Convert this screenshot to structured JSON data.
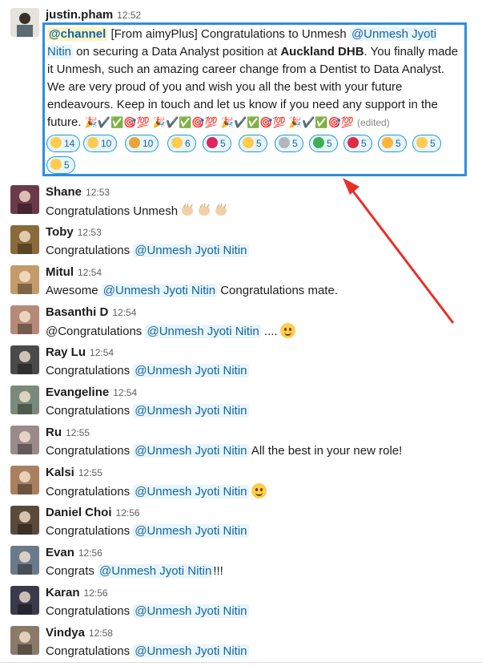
{
  "first_message": {
    "author": "justin.pham",
    "time": "12:52",
    "channel_tag": "@channel",
    "text_a": " [From aimyPlus] Congratulations to Unmesh ",
    "mention": "@Unmesh Jyoti Nitin",
    "text_b": " on securing a Data Analyst position at ",
    "bold": "Auckland DHB",
    "text_c": ". You finally made it Unmesh, such an amazing career change from a Dentist to Data Analyst. We are very proud of you and wish you all the best with your future endeavours. Keep in touch and let us know if you need any support in the future. ",
    "emoji_run": "🎉✔️✅🎯💯 🎉✔️✅🎯💯 🎉✔️✅🎯💯 🎉✔️✅🎯💯",
    "edited": "(edited)",
    "reactions": [
      {
        "icon": "thumbs-up-icon",
        "count": "14",
        "color": "#ffcc4d"
      },
      {
        "icon": "clap-icon",
        "count": "10",
        "color": "#ffcc4d"
      },
      {
        "icon": "party-popper-icon",
        "count": "10",
        "color": "#e8a33d"
      },
      {
        "icon": "grin-icon",
        "count": "6",
        "color": "#ffcc4d"
      },
      {
        "icon": "hundred-icon",
        "count": "5",
        "color": "#e0245e"
      },
      {
        "icon": "slight-smile-icon",
        "count": "5",
        "color": "#ffcc4d"
      },
      {
        "icon": "heavy-check-icon",
        "count": "5",
        "color": "#b0b8bf"
      },
      {
        "icon": "white-check-icon",
        "count": "5",
        "color": "#3cb054"
      },
      {
        "icon": "target-icon",
        "count": "5",
        "color": "#dd2e44"
      },
      {
        "icon": "muscle-icon",
        "count": "5",
        "color": "#ffb536"
      },
      {
        "icon": "hugging-icon",
        "count": "5",
        "color": "#ffcc4d"
      },
      {
        "icon": "sun-icon",
        "count": "5",
        "color": "#ffcc4d"
      }
    ]
  },
  "messages": [
    {
      "author": "Shane",
      "time": "12:53",
      "pre": "Congratulations Unmesh",
      "mention": "",
      "post": "",
      "emoji": "clap3"
    },
    {
      "author": "Toby",
      "time": "12:53",
      "pre": "Congratulations ",
      "mention": "@Unmesh Jyoti Nitin",
      "post": "",
      "emoji": ""
    },
    {
      "author": "Mitul",
      "time": "12:54",
      "pre": "Awesome ",
      "mention": "@Unmesh Jyoti Nitin",
      "post": " Congratulations mate.",
      "emoji": ""
    },
    {
      "author": "Basanthi D",
      "time": "12:54",
      "pre": "@Congratulations ",
      "mention": "@Unmesh Jyoti Nitin",
      "post": " ....",
      "emoji": "smile"
    },
    {
      "author": "Ray Lu",
      "time": "12:54",
      "pre": "Congratulations ",
      "mention": "@Unmesh Jyoti Nitin",
      "post": "",
      "emoji": ""
    },
    {
      "author": "Evangeline",
      "time": "12:54",
      "pre": "Congratulations ",
      "mention": "@Unmesh Jyoti Nitin",
      "post": "",
      "emoji": ""
    },
    {
      "author": "Ru",
      "time": "12:55",
      "pre": "Congratulations ",
      "mention": "@Unmesh Jyoti Nitin",
      "post": " All the best in your new role!",
      "emoji": ""
    },
    {
      "author": "Kalsi",
      "time": "12:55",
      "pre": "Congratulations ",
      "mention": "@Unmesh Jyoti Nitin",
      "post": "",
      "emoji": "smile"
    },
    {
      "author": "Daniel Choi",
      "time": "12:56",
      "pre": "Congratulations ",
      "mention": "@Unmesh Jyoti Nitin",
      "post": "",
      "emoji": ""
    },
    {
      "author": "Evan",
      "time": "12:56",
      "pre": "Congrats ",
      "mention": "@Unmesh Jyoti Nitin",
      "post": "!!!",
      "emoji": ""
    },
    {
      "author": "Karan",
      "time": "12:56",
      "pre": "Congratulations ",
      "mention": "@Unmesh Jyoti Nitin",
      "post": "",
      "emoji": ""
    },
    {
      "author": "Vindya",
      "time": "12:58",
      "pre": "Congratulations ",
      "mention": "@Unmesh Jyoti Nitin",
      "post": "",
      "emoji": ""
    }
  ],
  "colors": {
    "mention": "#1264a3",
    "mention_bg": "#e8f5fa",
    "highlight_border": "#2e8ee0",
    "arrow": "#e8302a"
  }
}
